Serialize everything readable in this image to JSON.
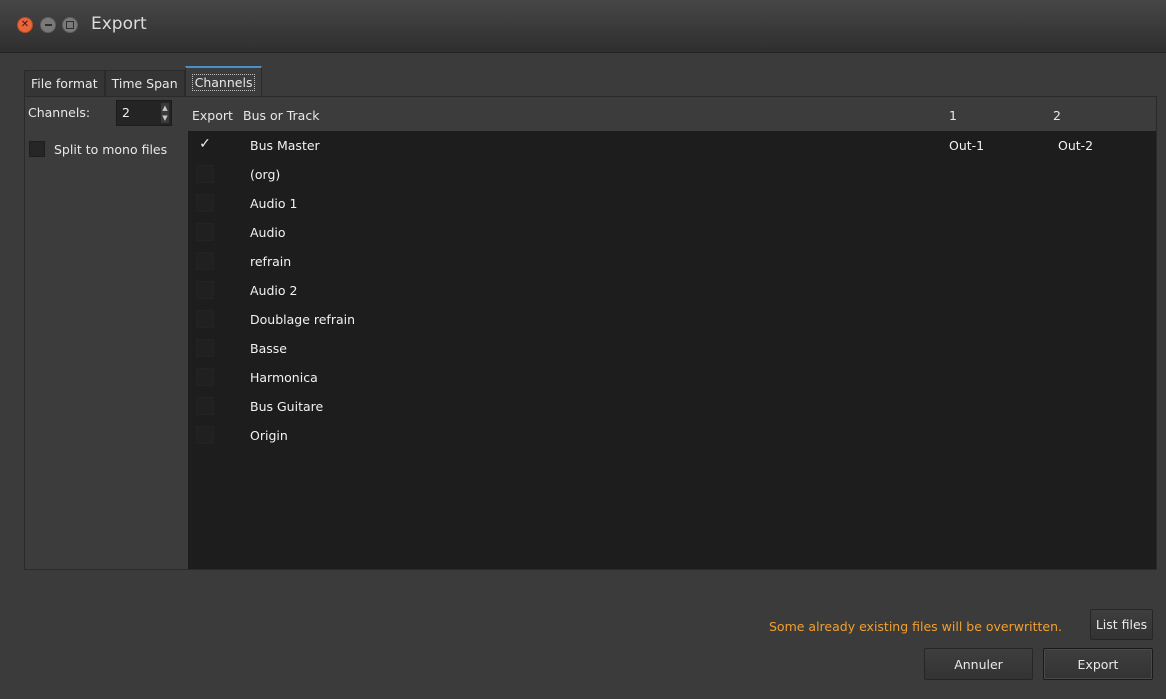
{
  "window": {
    "title": "Export"
  },
  "tabs": [
    {
      "label": "File format",
      "active": false
    },
    {
      "label": "Time Span",
      "active": false
    },
    {
      "label": "Channels",
      "active": true
    }
  ],
  "channels": {
    "label": "Channels:",
    "value": "2",
    "split_label": "Split to mono files",
    "split_checked": false
  },
  "table": {
    "headers": {
      "export": "Export",
      "bus_or_track": "Bus or Track",
      "col1": "1",
      "col2": "2"
    },
    "rows": [
      {
        "checked": true,
        "check_glyph": "✓",
        "name": "Bus Master",
        "out1": "Out-1",
        "out2": "Out-2"
      },
      {
        "checked": false,
        "check_glyph": "",
        "name": "(org)",
        "out1": "",
        "out2": ""
      },
      {
        "checked": false,
        "check_glyph": "",
        "name": "Audio 1",
        "out1": "",
        "out2": ""
      },
      {
        "checked": false,
        "check_glyph": "",
        "name": "Audio",
        "out1": "",
        "out2": ""
      },
      {
        "checked": false,
        "check_glyph": "",
        "name": "refrain",
        "out1": "",
        "out2": ""
      },
      {
        "checked": false,
        "check_glyph": "",
        "name": "Audio 2",
        "out1": "",
        "out2": ""
      },
      {
        "checked": false,
        "check_glyph": "",
        "name": "Doublage refrain",
        "out1": "",
        "out2": ""
      },
      {
        "checked": false,
        "check_glyph": "",
        "name": "Basse",
        "out1": "",
        "out2": ""
      },
      {
        "checked": false,
        "check_glyph": "",
        "name": "Harmonica",
        "out1": "",
        "out2": ""
      },
      {
        "checked": false,
        "check_glyph": "",
        "name": "Bus Guitare",
        "out1": "",
        "out2": ""
      },
      {
        "checked": false,
        "check_glyph": "",
        "name": "Origin",
        "out1": "",
        "out2": ""
      }
    ]
  },
  "footer": {
    "warning": "Some already existing files will be overwritten.",
    "list_files": "List files",
    "cancel": "Annuler",
    "export": "Export"
  },
  "colors": {
    "accent": "#4a90c8",
    "warning": "#f0a030",
    "close_button": "#e9653b"
  }
}
